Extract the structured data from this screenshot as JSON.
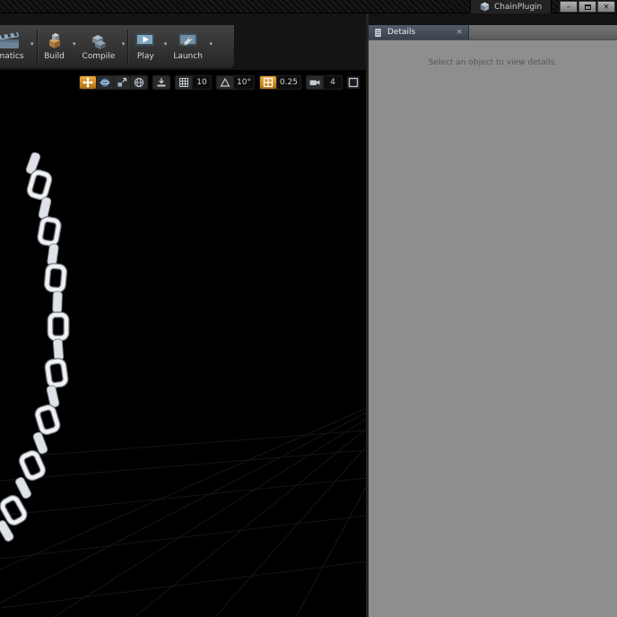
{
  "window": {
    "title": "ChainPlugin",
    "minimize_glyph": "–",
    "close_glyph": "×"
  },
  "toolbar": {
    "dropdown_glyph": "▾",
    "items": [
      {
        "label": "ematics"
      },
      {
        "label": "Build"
      },
      {
        "label": "Compile"
      },
      {
        "label": "Play"
      },
      {
        "label": "Launch"
      }
    ]
  },
  "viewport_toolbar": {
    "grid_snap": "10",
    "rotation_snap": "10°",
    "scale_snap": "0.25",
    "camera_speed": "4"
  },
  "details": {
    "tab": "Details",
    "close_glyph": "×",
    "empty_message": "Select an object to view details."
  },
  "colors": {
    "accent_orange": "#cf8a26",
    "panel_gray": "#8e8e8e",
    "toolbar_dark": "#2e2e2e",
    "viewport_black": "#000000"
  }
}
